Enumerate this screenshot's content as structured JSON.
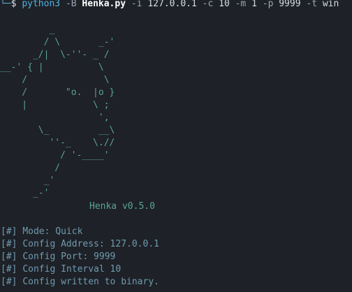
{
  "prompt": {
    "corner": "└─",
    "dollar": "$",
    "program": "python3",
    "flag_b": "-B",
    "script": "Henka.py",
    "flag_i": "-i",
    "ip": "127.0.0.1",
    "flag_c": "-c",
    "count": "10",
    "flag_m": "-m",
    "mode": "1",
    "flag_p": "-p",
    "port": "9999",
    "flag_t": "-t",
    "target": "win"
  },
  "banner": {
    "art": "         _\n        / \\       _-'\n      _/|  \\-''- _ /\n__-' { |          \\\n    /              \\\n    /       \"o.  |o }\n    |            \\ ;\n                  ',\n       \\_         __\\\n         ''-_    \\.//\n           / '-____'\n          /\n        _'\n      _-'",
    "version": "Henka v0.5.0"
  },
  "log": [
    {
      "tag": "[#]",
      "message": "Mode: Quick"
    },
    {
      "tag": "[#]",
      "message": "Config Address: 127.0.0.1"
    },
    {
      "tag": "[#]",
      "message": "Config Port: 9999"
    },
    {
      "tag": "[#]",
      "message": "Config Interval 10"
    },
    {
      "tag": "[#]",
      "message": "Config written to binary."
    }
  ],
  "colors": {
    "background": "#1e2127",
    "command": "#4fb3e6",
    "banner": "#5aa39a",
    "log": "#6f9bb0"
  }
}
